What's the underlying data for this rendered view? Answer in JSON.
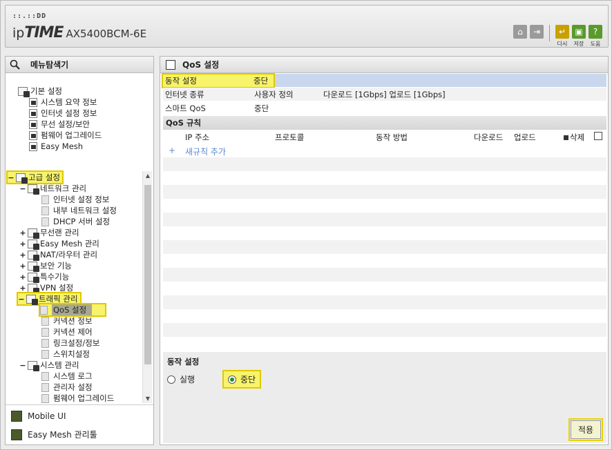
{
  "header": {
    "logo_dots": "::.::DD",
    "brand_ip": "ip",
    "brand_time": "TIME",
    "model": "AX5400BCM-6E",
    "buttons": [
      {
        "name": "home",
        "label": ""
      },
      {
        "name": "logout",
        "label": ""
      },
      {
        "name": "reload",
        "label": "다시"
      },
      {
        "name": "save",
        "label": "저장"
      },
      {
        "name": "help",
        "label": "도움"
      }
    ]
  },
  "left": {
    "title": "메뉴탐색기",
    "basic": {
      "label": "기본 설정",
      "items": [
        "시스템 요약 정보",
        "인터넷 설정 정보",
        "무선 설정/보안",
        "펌웨어 업그레이드",
        "Easy Mesh"
      ]
    },
    "advanced": {
      "label": "고급 설정",
      "network": {
        "label": "네트워크 관리",
        "items": [
          "인터넷 설정 정보",
          "내부 네트워크 설정",
          "DHCP 서버 설정"
        ]
      },
      "wireless": "무선랜 관리",
      "easymesh": "Easy Mesh 관리",
      "nat": "NAT/라우터 관리",
      "security": "보안 기능",
      "special": "특수기능",
      "vpn": "VPN 설정",
      "traffic": {
        "label": "트래픽 관리",
        "items": [
          "QoS 설정",
          "커넥션 정보",
          "커넥션 제어",
          "링크설정/정보",
          "스위치설정"
        ]
      },
      "system": {
        "label": "시스템 관리",
        "items": [
          "시스템 로그",
          "관리자 설정",
          "펌웨어 업그레이드"
        ]
      }
    },
    "footer": [
      "Mobile UI",
      "Easy Mesh 관리툴"
    ]
  },
  "main": {
    "title": "QoS 설정",
    "status_rows": [
      {
        "label": "동작 설정",
        "value": "중단",
        "extra": ""
      },
      {
        "label": "인터넷 종류",
        "value": "사용자 정의",
        "extra": "다운로드 [1Gbps] 업로드 [1Gbps]"
      },
      {
        "label": "스마트 QoS",
        "value": "중단",
        "extra": ""
      }
    ],
    "rules_title": "QoS 규칙",
    "columns": {
      "ip": "IP 주소",
      "protocol": "프로토콜",
      "method": "동작 방법",
      "download": "다운로드",
      "upload": "업로드",
      "delete": "삭제"
    },
    "add_rule": "새규칙 추가",
    "bottom": {
      "title": "동작 설정",
      "options": [
        {
          "label": "실행",
          "checked": false
        },
        {
          "label": "중단",
          "checked": true
        }
      ],
      "apply": "적용"
    }
  }
}
